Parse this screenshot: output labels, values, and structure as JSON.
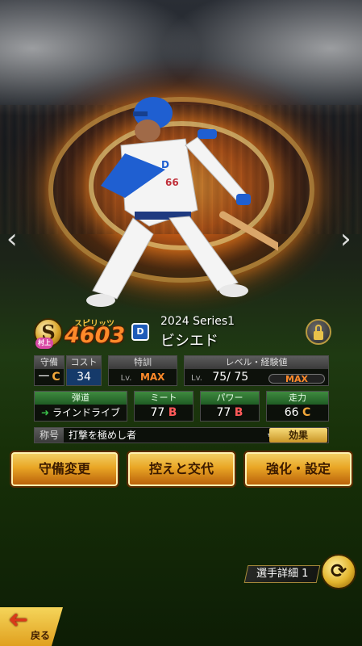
{
  "player": {
    "rank_letter": "S",
    "rank_mini": "村上",
    "spirits_label": "スピリッツ",
    "spirits_value": "4603",
    "team_logo": "D",
    "series": "2024 Series1",
    "name": "ビシエド",
    "jersey_number": "66"
  },
  "stats_row1": {
    "position_label": "守備",
    "position_value": "一",
    "position_grade": "C",
    "cost_label": "コスト",
    "cost_value": "34",
    "training_label": "特訓",
    "training_lv": "Lv.",
    "training_max": "MAX",
    "level_label": "レベル・経験値",
    "level_lv": "Lv.",
    "level_value": "75/ 75",
    "level_max": "MAX"
  },
  "stats_row2": {
    "trajectory_label": "弾道",
    "trajectory_value": "ラインドライブ",
    "meet_label": "ミート",
    "meet_value": "77",
    "meet_grade": "B",
    "power_label": "パワー",
    "power_value": "77",
    "power_grade": "B",
    "speed_label": "走力",
    "speed_value": "66",
    "speed_grade": "C"
  },
  "title_row": {
    "label": "称号",
    "text": "打撃を極めし者",
    "stars": "★★★★",
    "effect_button": "効果"
  },
  "actions": {
    "defense_change": "守備変更",
    "bench_swap": "控えと交代",
    "enhance_settings": "強化・設定"
  },
  "detail": {
    "label": "選手詳細 1"
  },
  "back": {
    "label": "戻る"
  },
  "colors": {
    "accent_gold": "#e9a625",
    "grade_b": "#ff5a5a",
    "grade_c": "#f2a83a",
    "spirits_orange": "#ff8a2a"
  }
}
